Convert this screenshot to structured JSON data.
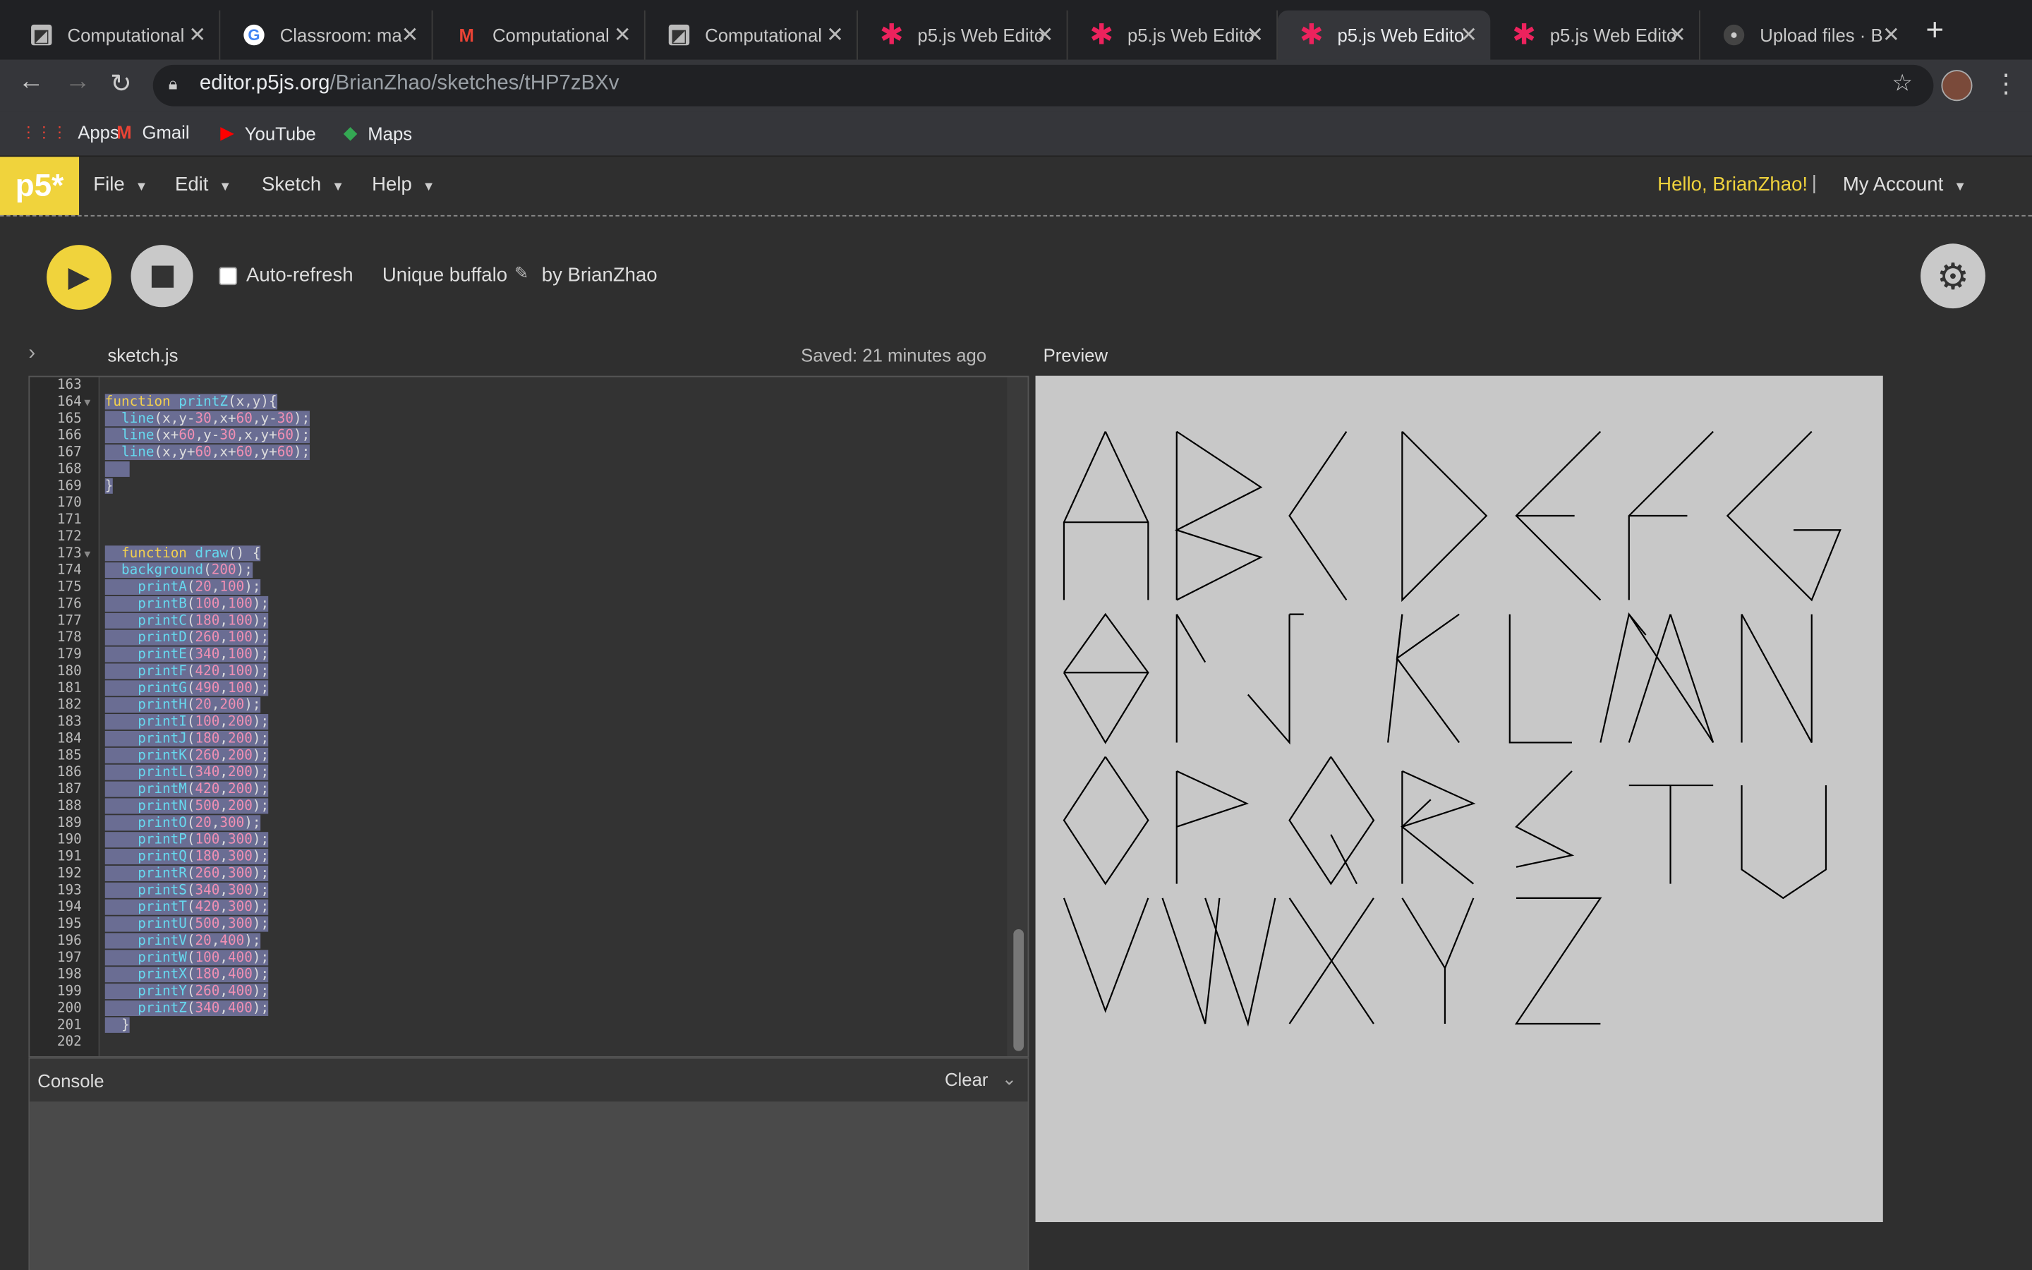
{
  "browser": {
    "tabs": [
      {
        "title": "Computational",
        "icon": "processing-icon"
      },
      {
        "title": "Classroom: ma",
        "icon": "google-icon"
      },
      {
        "title": "Computational",
        "icon": "gmail-icon"
      },
      {
        "title": "Computational",
        "icon": "processing-icon"
      },
      {
        "title": "p5.js Web Edito",
        "icon": "p5-asterisk-icon"
      },
      {
        "title": "p5.js Web Edito",
        "icon": "p5-asterisk-icon"
      },
      {
        "title": "p5.js Web Edito",
        "icon": "p5-asterisk-icon",
        "active": true
      },
      {
        "title": "p5.js Web Edito",
        "icon": "p5-asterisk-icon"
      },
      {
        "title": "Upload files · B",
        "icon": "github-icon"
      }
    ],
    "url_host": "editor.p5js.org",
    "url_path": "/BrianZhao/sketches/tHP7zBXv",
    "bookmarks": [
      "Apps",
      "Gmail",
      "YouTube",
      "Maps"
    ]
  },
  "app": {
    "logo": "p5*",
    "menu": [
      "File",
      "Edit",
      "Sketch",
      "Help"
    ],
    "greeting": "Hello, BrianZhao!",
    "separator": "|",
    "account": "My Account"
  },
  "toolbar": {
    "auto_refresh_label": "Auto-refresh",
    "auto_refresh_checked": false,
    "sketch_name": "Unique buffalo",
    "byline": "by BrianZhao"
  },
  "editor": {
    "filename": "sketch.js",
    "saved_status": "Saved: 21 minutes ago",
    "lines": [
      {
        "n": "163",
        "text": "",
        "hl": false
      },
      {
        "n": "164",
        "text": "function printZ(x,y){",
        "hl": true,
        "fold": true
      },
      {
        "n": "165",
        "text": "  line(x,y-30,x+60,y-30);",
        "hl": true
      },
      {
        "n": "166",
        "text": "  line(x+60,y-30,x,y+60);",
        "hl": true
      },
      {
        "n": "167",
        "text": "  line(x,y+60,x+60,y+60);",
        "hl": true
      },
      {
        "n": "168",
        "text": "   ",
        "hl": true
      },
      {
        "n": "169",
        "text": "}",
        "hl": true
      },
      {
        "n": "170",
        "text": "",
        "hl": false
      },
      {
        "n": "171",
        "text": "",
        "hl": false
      },
      {
        "n": "172",
        "text": "",
        "hl": false
      },
      {
        "n": "173",
        "text": "  function draw() {",
        "hl": true,
        "fold": true
      },
      {
        "n": "174",
        "text": "  background(200);",
        "hl": true
      },
      {
        "n": "175",
        "text": "    printA(20,100);",
        "hl": true
      },
      {
        "n": "176",
        "text": "    printB(100,100);",
        "hl": true
      },
      {
        "n": "177",
        "text": "    printC(180,100);",
        "hl": true
      },
      {
        "n": "178",
        "text": "    printD(260,100);",
        "hl": true
      },
      {
        "n": "179",
        "text": "    printE(340,100);",
        "hl": true
      },
      {
        "n": "180",
        "text": "    printF(420,100);",
        "hl": true
      },
      {
        "n": "181",
        "text": "    printG(490,100);",
        "hl": true
      },
      {
        "n": "182",
        "text": "    printH(20,200);",
        "hl": true
      },
      {
        "n": "183",
        "text": "    printI(100,200);",
        "hl": true
      },
      {
        "n": "184",
        "text": "    printJ(180,200);",
        "hl": true
      },
      {
        "n": "185",
        "text": "    printK(260,200);",
        "hl": true
      },
      {
        "n": "186",
        "text": "    printL(340,200);",
        "hl": true
      },
      {
        "n": "187",
        "text": "    printM(420,200);",
        "hl": true
      },
      {
        "n": "188",
        "text": "    printN(500,200);",
        "hl": true
      },
      {
        "n": "189",
        "text": "    printO(20,300);",
        "hl": true
      },
      {
        "n": "190",
        "text": "    printP(100,300);",
        "hl": true
      },
      {
        "n": "191",
        "text": "    printQ(180,300);",
        "hl": true
      },
      {
        "n": "192",
        "text": "    printR(260,300);",
        "hl": true
      },
      {
        "n": "193",
        "text": "    printS(340,300);",
        "hl": true
      },
      {
        "n": "194",
        "text": "    printT(420,300);",
        "hl": true
      },
      {
        "n": "195",
        "text": "    printU(500,300);",
        "hl": true
      },
      {
        "n": "196",
        "text": "    printV(20,400);",
        "hl": true
      },
      {
        "n": "197",
        "text": "    printW(100,400);",
        "hl": true
      },
      {
        "n": "198",
        "text": "    printX(180,400);",
        "hl": true
      },
      {
        "n": "199",
        "text": "    printY(260,400);",
        "hl": true
      },
      {
        "n": "200",
        "text": "    printZ(340,400);",
        "hl": true
      },
      {
        "n": "201",
        "text": "  }",
        "hl": true
      },
      {
        "n": "202",
        "text": "",
        "hl": false
      }
    ]
  },
  "console": {
    "label": "Console",
    "clear_label": "Clear"
  },
  "preview": {
    "label": "Preview",
    "background": "#c8c8c8",
    "letters": [
      "A",
      "B",
      "C",
      "D",
      "E",
      "F",
      "G",
      "H",
      "I",
      "J",
      "K",
      "L",
      "M",
      "N",
      "O",
      "P",
      "Q",
      "R",
      "S",
      "T",
      "U",
      "V",
      "W",
      "X",
      "Y",
      "Z"
    ]
  },
  "colors": {
    "accent_yellow": "#f0d33c",
    "selection": "#6a6d93",
    "keyword": "#f3d04e",
    "function_name": "#66d9ef",
    "number": "#f08fb3"
  }
}
